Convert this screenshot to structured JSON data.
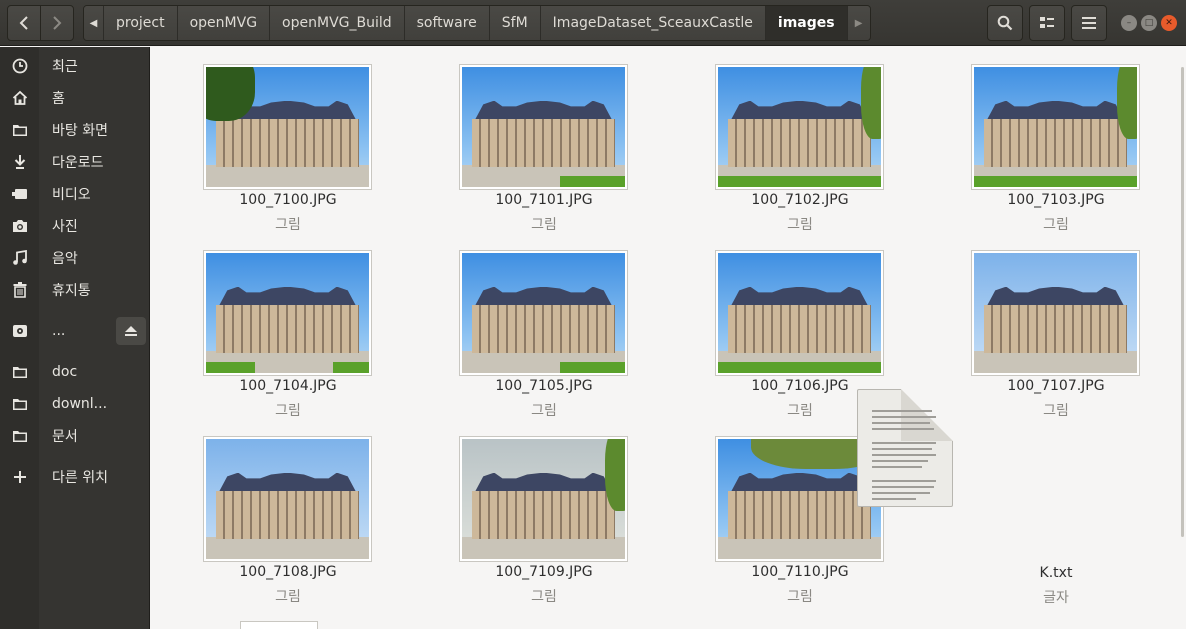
{
  "toolbar": {
    "back_icon": "chevron-left",
    "forward_icon": "chevron-right",
    "crumb_scroll_left": "◀",
    "crumb_scroll_right": "▶",
    "search_icon": "search",
    "view_icon": "list-view",
    "menu_icon": "hamburger"
  },
  "breadcrumbs": [
    {
      "label": "project"
    },
    {
      "label": "openMVG"
    },
    {
      "label": "openMVG_Build"
    },
    {
      "label": "software"
    },
    {
      "label": "SfM"
    },
    {
      "label": "ImageDataset_SceauxCastle"
    },
    {
      "label": "images",
      "active": true
    }
  ],
  "sidebar": {
    "items": [
      {
        "label": "최근",
        "icon": "clock-icon"
      },
      {
        "label": "홈",
        "icon": "home-icon"
      },
      {
        "label": "바탕 화면",
        "icon": "folder-icon"
      },
      {
        "label": "다운로드",
        "icon": "download-icon"
      },
      {
        "label": "비디오",
        "icon": "video-icon"
      },
      {
        "label": "사진",
        "icon": "camera-icon"
      },
      {
        "label": "음악",
        "icon": "music-icon"
      },
      {
        "label": "휴지통",
        "icon": "trash-icon"
      },
      {
        "label": "...",
        "icon": "disk-icon"
      },
      {
        "label": "doc",
        "icon": "folder-icon"
      },
      {
        "label": "downl...",
        "icon": "folder-icon"
      },
      {
        "label": "문서",
        "icon": "folder-icon"
      },
      {
        "label": "다른 위치",
        "icon": "plus-icon"
      }
    ]
  },
  "files": [
    {
      "name": "100_7100.JPG",
      "type": "그림"
    },
    {
      "name": "100_7101.JPG",
      "type": "그림"
    },
    {
      "name": "100_7102.JPG",
      "type": "그림"
    },
    {
      "name": "100_7103.JPG",
      "type": "그림"
    },
    {
      "name": "100_7104.JPG",
      "type": "그림"
    },
    {
      "name": "100_7105.JPG",
      "type": "그림"
    },
    {
      "name": "100_7106.JPG",
      "type": "그림"
    },
    {
      "name": "100_7107.JPG",
      "type": "그림"
    },
    {
      "name": "100_7108.JPG",
      "type": "그림"
    },
    {
      "name": "100_7109.JPG",
      "type": "그림"
    },
    {
      "name": "100_7110.JPG",
      "type": "그림"
    },
    {
      "name": "K.txt",
      "type": "글자"
    }
  ],
  "colors": {
    "headerbar": "#3c3b37",
    "sidebar": "#353431",
    "content": "#f6f5f4",
    "close_button": "#e85b2b"
  }
}
